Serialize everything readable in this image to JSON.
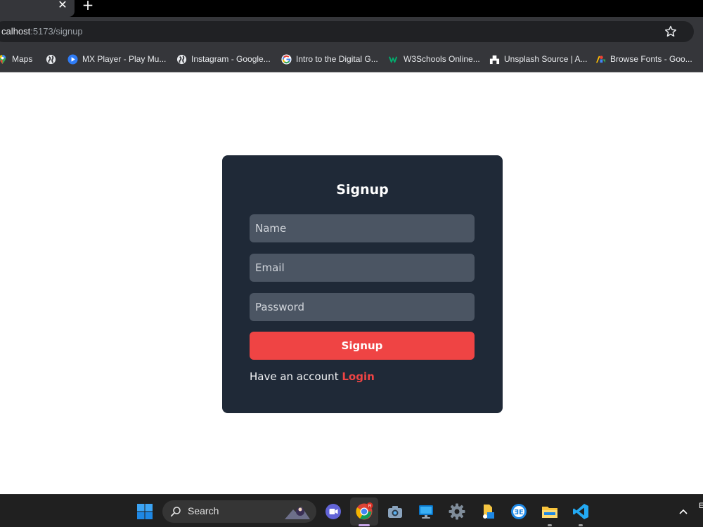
{
  "browser": {
    "url_host": "calhost",
    "url_rest": ":5173/signup",
    "tab_close_glyph": "✕",
    "new_tab_glyph": "+",
    "bookmarks": [
      {
        "label": "Maps",
        "icon": "maps-icon"
      },
      {
        "label": "",
        "icon": "globe-icon"
      },
      {
        "label": "MX Player - Play Mu...",
        "icon": "mx-player-icon"
      },
      {
        "label": "Instagram - Google...",
        "icon": "globe-icon"
      },
      {
        "label": "Intro to the Digital G...",
        "icon": "google-icon"
      },
      {
        "label": "W3Schools Online...",
        "icon": "w3schools-icon"
      },
      {
        "label": "Unsplash Source | A...",
        "icon": "unsplash-icon"
      },
      {
        "label": "Browse Fonts - Goo...",
        "icon": "google-fonts-icon"
      }
    ]
  },
  "signup": {
    "title": "Signup",
    "name_placeholder": "Name",
    "email_placeholder": "Email",
    "password_placeholder": "Password",
    "submit_label": "Signup",
    "have_account_text": "Have an account",
    "login_link": "Login"
  },
  "taskbar": {
    "search_label": "Search",
    "edge_text": "E"
  },
  "colors": {
    "card_bg": "#1f2937",
    "input_bg": "#4b5563",
    "accent": "#ef4444"
  }
}
